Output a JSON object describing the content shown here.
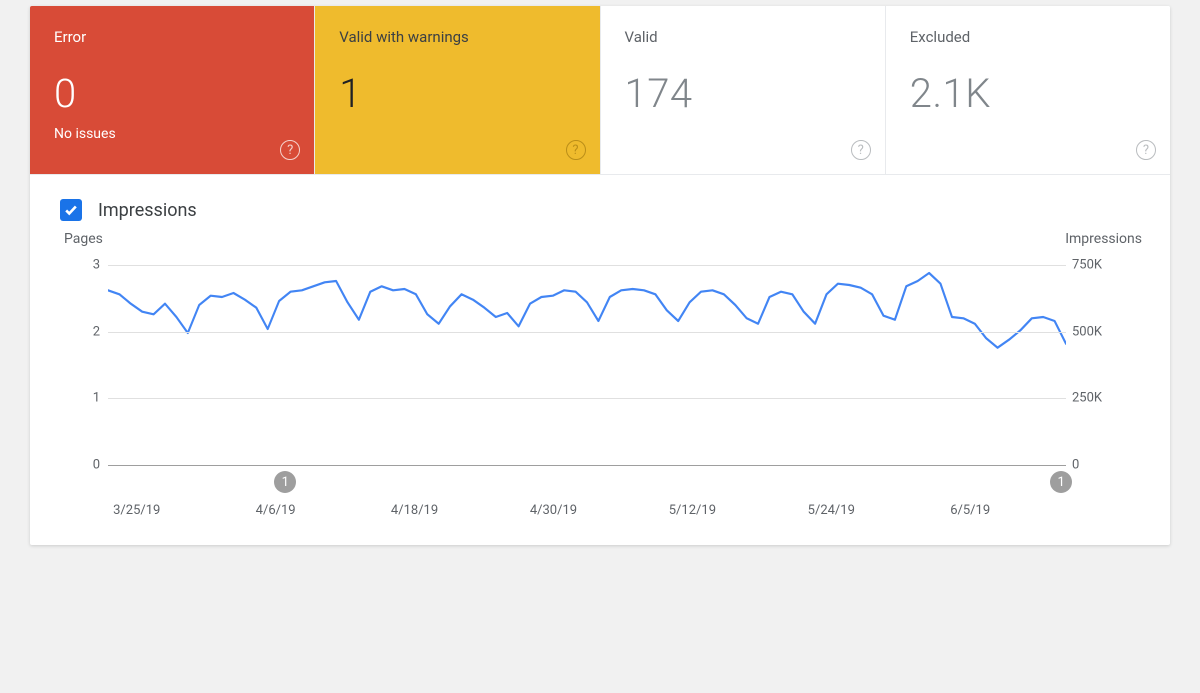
{
  "tiles": {
    "error": {
      "label": "Error",
      "value": "0",
      "sub": "No issues"
    },
    "warn": {
      "label": "Valid with warnings",
      "value": "1"
    },
    "valid": {
      "label": "Valid",
      "value": "174"
    },
    "excluded": {
      "label": "Excluded",
      "value": "2.1K"
    }
  },
  "controls": {
    "impressions_label": "Impressions"
  },
  "axes": {
    "left_title": "Pages",
    "right_title": "Impressions",
    "left_ticks": [
      "0",
      "1",
      "2",
      "3"
    ],
    "right_ticks": [
      "0",
      "250K",
      "500K",
      "750K"
    ]
  },
  "xticks": [
    {
      "label": "3/25/19",
      "pos": 0.03
    },
    {
      "label": "4/6/19",
      "pos": 0.175
    },
    {
      "label": "4/18/19",
      "pos": 0.32
    },
    {
      "label": "4/30/19",
      "pos": 0.465
    },
    {
      "label": "5/12/19",
      "pos": 0.61
    },
    {
      "label": "5/24/19",
      "pos": 0.755
    },
    {
      "label": "6/5/19",
      "pos": 0.9
    }
  ],
  "markers": [
    {
      "label": "1",
      "pos": 0.185
    },
    {
      "label": "1",
      "pos": 0.995
    }
  ],
  "chart_data": {
    "type": "line",
    "title": "",
    "xlabel": "",
    "ylabel_left": "Pages",
    "ylabel_right": "Impressions",
    "ylim_right": [
      0,
      750000
    ],
    "series": [
      {
        "name": "Impressions",
        "x": [
          "3/23/19",
          "3/24/19",
          "3/25/19",
          "3/26/19",
          "3/27/19",
          "3/28/19",
          "3/29/19",
          "3/30/19",
          "3/31/19",
          "4/1/19",
          "4/2/19",
          "4/3/19",
          "4/4/19",
          "4/5/19",
          "4/6/19",
          "4/7/19",
          "4/8/19",
          "4/9/19",
          "4/10/19",
          "4/11/19",
          "4/12/19",
          "4/13/19",
          "4/14/19",
          "4/15/19",
          "4/16/19",
          "4/17/19",
          "4/18/19",
          "4/19/19",
          "4/20/19",
          "4/21/19",
          "4/22/19",
          "4/23/19",
          "4/24/19",
          "4/25/19",
          "4/26/19",
          "4/27/19",
          "4/28/19",
          "4/29/19",
          "4/30/19",
          "5/1/19",
          "5/2/19",
          "5/3/19",
          "5/4/19",
          "5/5/19",
          "5/6/19",
          "5/7/19",
          "5/8/19",
          "5/9/19",
          "5/10/19",
          "5/11/19",
          "5/12/19",
          "5/13/19",
          "5/14/19",
          "5/15/19",
          "5/16/19",
          "5/17/19",
          "5/18/19",
          "5/19/19",
          "5/20/19",
          "5/21/19",
          "5/22/19",
          "5/23/19",
          "5/24/19",
          "5/25/19",
          "5/26/19",
          "5/27/19",
          "5/28/19",
          "5/29/19",
          "5/30/19",
          "5/31/19",
          "6/1/19",
          "6/2/19",
          "6/3/19",
          "6/4/19",
          "6/5/19",
          "6/6/19",
          "6/7/19",
          "6/8/19",
          "6/9/19",
          "6/10/19",
          "6/11/19",
          "6/12/19",
          "6/13/19"
        ],
        "values": [
          655000,
          640000,
          605000,
          575000,
          565000,
          605000,
          555000,
          495000,
          600000,
          635000,
          630000,
          645000,
          620000,
          590000,
          510000,
          615000,
          650000,
          655000,
          670000,
          685000,
          690000,
          610000,
          545000,
          650000,
          670000,
          655000,
          660000,
          640000,
          565000,
          530000,
          595000,
          640000,
          620000,
          590000,
          555000,
          570000,
          520000,
          605000,
          630000,
          635000,
          655000,
          650000,
          610000,
          540000,
          630000,
          655000,
          660000,
          655000,
          640000,
          580000,
          540000,
          610000,
          650000,
          655000,
          640000,
          600000,
          550000,
          530000,
          630000,
          650000,
          640000,
          575000,
          530000,
          640000,
          680000,
          675000,
          665000,
          640000,
          560000,
          545000,
          670000,
          690000,
          720000,
          680000,
          555000,
          550000,
          530000,
          475000,
          440000,
          470000,
          505000,
          550000,
          555000,
          540000,
          455000
        ]
      }
    ]
  }
}
